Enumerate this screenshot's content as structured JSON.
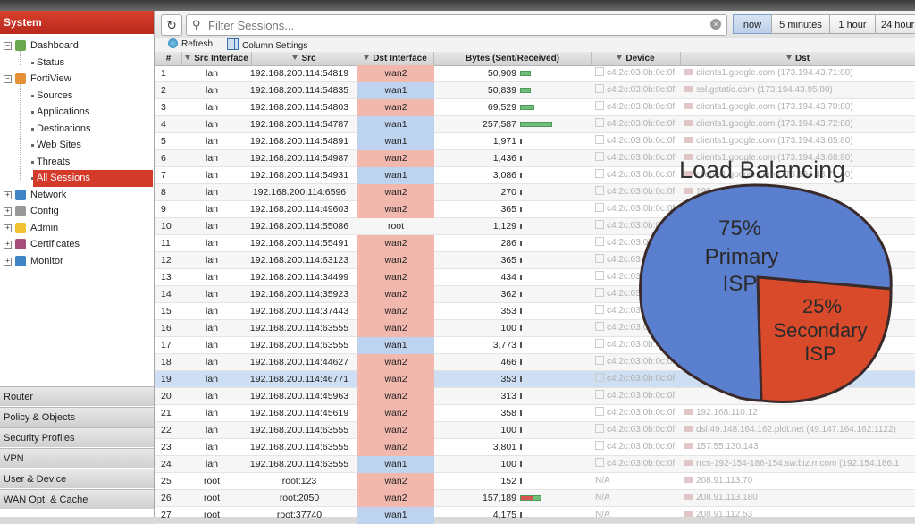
{
  "sidebar": {
    "header": "System",
    "tree": [
      {
        "label": "Dashboard",
        "icon": "dashboard-icon",
        "type": "folder"
      },
      {
        "label": "Status",
        "type": "child"
      },
      {
        "label": "FortiView",
        "icon": "fortiview-icon",
        "type": "folder"
      },
      {
        "label": "Sources",
        "type": "child"
      },
      {
        "label": "Applications",
        "type": "child"
      },
      {
        "label": "Destinations",
        "type": "child"
      },
      {
        "label": "Web Sites",
        "type": "child"
      },
      {
        "label": "Threats",
        "type": "child"
      },
      {
        "label": "All Sessions",
        "type": "child",
        "selected": true
      },
      {
        "label": "Network",
        "icon": "network-icon",
        "type": "folder"
      },
      {
        "label": "Config",
        "icon": "config-icon",
        "type": "folder"
      },
      {
        "label": "Admin",
        "icon": "admin-icon",
        "type": "folder"
      },
      {
        "label": "Certificates",
        "icon": "certificates-icon",
        "type": "folder"
      },
      {
        "label": "Monitor",
        "icon": "monitor-icon",
        "type": "folder"
      }
    ],
    "sections": [
      "Router",
      "Policy & Objects",
      "Security Profiles",
      "VPN",
      "User & Device",
      "WAN Opt. & Cache"
    ]
  },
  "filter": {
    "placeholder": "Filter Sessions..."
  },
  "time_buttons": [
    {
      "label": "now",
      "active": true
    },
    {
      "label": "5 minutes"
    },
    {
      "label": "1 hour"
    },
    {
      "label": "24 hour"
    }
  ],
  "toolbar": {
    "refresh": "Refresh",
    "columns": "Column Settings"
  },
  "columns": [
    "#",
    "Src Interface",
    "Src",
    "Dst Interface",
    "Bytes (Sent/Received)",
    "Device",
    "Dst"
  ],
  "rows": [
    {
      "n": "1",
      "si": "lan",
      "src": "192.168.200.114:54819",
      "dst": "wan2",
      "bytes": "50,909",
      "frac": 0.15,
      "dev": "c4:2c:03:0b:0c:0f",
      "dest": "clients1.google.com (173.194.43.71:80)"
    },
    {
      "n": "2",
      "si": "lan",
      "src": "192.168.200.114:54835",
      "dst": "wan1",
      "bytes": "50,839",
      "frac": 0.15,
      "dev": "c4:2c:03:0b:0c:0f",
      "dest": "ssl.gstatic.com (173.194.43.95:80)"
    },
    {
      "n": "3",
      "si": "lan",
      "src": "192.168.200.114:54803",
      "dst": "wan2",
      "bytes": "69,529",
      "frac": 0.2,
      "dev": "c4:2c:03:0b:0c:0f",
      "dest": "clients1.google.com (173.194.43.70:80)"
    },
    {
      "n": "4",
      "si": "lan",
      "src": "192.168.200.114:54787",
      "dst": "wan1",
      "bytes": "257,587",
      "frac": 0.45,
      "dev": "c4:2c:03:0b:0c:0f",
      "dest": "clients1.google.com (173.194.43.72:80)"
    },
    {
      "n": "5",
      "si": "lan",
      "src": "192.168.200.114:54891",
      "dst": "wan1",
      "bytes": "1,971",
      "frac": 0.02,
      "dev": "c4:2c:03:0b:0c:0f",
      "dest": "clients1.google.com (173.194.43.65:80)"
    },
    {
      "n": "6",
      "si": "lan",
      "src": "192.168.200.114:54987",
      "dst": "wan2",
      "bytes": "1,436",
      "frac": 0.02,
      "dev": "c4:2c:03:0b:0c:0f",
      "dest": "clients1.google.com (173.194.43.68:80)"
    },
    {
      "n": "7",
      "si": "lan",
      "src": "192.168.200.114:54931",
      "dst": "wan1",
      "bytes": "3,086",
      "frac": 0.02,
      "dev": "c4:2c:03:0b:0c:0f",
      "dest": "clients1.google.com (173.194.43.71:80)"
    },
    {
      "n": "8",
      "si": "lan",
      "src": "192.168.200.114:6596",
      "dst": "wan2",
      "bytes": "270",
      "frac": 0.01,
      "dev": "c4:2c:03:0b:0c:0f",
      "dest": "192.168.110.12"
    },
    {
      "n": "9",
      "si": "lan",
      "src": "192.168.200.114:49603",
      "dst": "wan2",
      "bytes": "365",
      "frac": 0.01,
      "dev": "c4:2c:03:0b:0c:0f",
      "dest": ""
    },
    {
      "n": "10",
      "si": "lan",
      "src": "192.168.200.114:55086",
      "dst": "root",
      "bytes": "1,129",
      "frac": 0.01,
      "dev": "c4:2c:03:0b:0c:0f",
      "dest": ""
    },
    {
      "n": "11",
      "si": "lan",
      "src": "192.168.200.114:55491",
      "dst": "wan2",
      "bytes": "286",
      "frac": 0.01,
      "dev": "c4:2c:03:0b:0c:0f",
      "dest": ""
    },
    {
      "n": "12",
      "si": "lan",
      "src": "192.168.200.114:63123",
      "dst": "wan2",
      "bytes": "365",
      "frac": 0.01,
      "dev": "c4:2c:03:0b:0c:0f",
      "dest": ""
    },
    {
      "n": "13",
      "si": "lan",
      "src": "192.168.200.114:34499",
      "dst": "wan2",
      "bytes": "434",
      "frac": 0.01,
      "dev": "c4:2c:03:0b:0c:0f",
      "dest": ""
    },
    {
      "n": "14",
      "si": "lan",
      "src": "192.168.200.114:35923",
      "dst": "wan2",
      "bytes": "362",
      "frac": 0.01,
      "dev": "c4:2c:03:0b:0c:0f",
      "dest": ""
    },
    {
      "n": "15",
      "si": "lan",
      "src": "192.168.200.114:37443",
      "dst": "wan2",
      "bytes": "353",
      "frac": 0.01,
      "dev": "c4:2c:03:0b:0c:0f",
      "dest": ""
    },
    {
      "n": "16",
      "si": "lan",
      "src": "192.168.200.114:63555",
      "dst": "wan2",
      "bytes": "100",
      "frac": 0.01,
      "dev": "c4:2c:03:0b:0c:0f",
      "dest": ".net"
    },
    {
      "n": "17",
      "si": "lan",
      "src": "192.168.200.114:63555",
      "dst": "wan1",
      "bytes": "3,773",
      "frac": 0.02,
      "dev": "c4:2c:03:0b:0c:0f",
      "dest": ""
    },
    {
      "n": "18",
      "si": "lan",
      "src": "192.168.200.114:44627",
      "dst": "wan2",
      "bytes": "466",
      "frac": 0.01,
      "dev": "c4:2c:03:0b:0c:0f",
      "dest": ""
    },
    {
      "n": "19",
      "si": "lan",
      "src": "192.168.200.114:46771",
      "dst": "wan2",
      "bytes": "353",
      "frac": 0.01,
      "dev": "c4:2c:03:0b:0c:0f",
      "dest": "",
      "selected": true
    },
    {
      "n": "20",
      "si": "lan",
      "src": "192.168.200.114:45963",
      "dst": "wan2",
      "bytes": "313",
      "frac": 0.01,
      "dev": "c4:2c:03:0b:0c:0f",
      "dest": ""
    },
    {
      "n": "21",
      "si": "lan",
      "src": "192.168.200.114:45619",
      "dst": "wan2",
      "bytes": "358",
      "frac": 0.01,
      "dev": "c4:2c:03:0b:0c:0f",
      "dest": "192.168.110.12"
    },
    {
      "n": "22",
      "si": "lan",
      "src": "192.168.200.114:63555",
      "dst": "wan2",
      "bytes": "100",
      "frac": 0.01,
      "dev": "c4:2c:03:0b:0c:0f",
      "dest": "dsl.49.148.164.162.pldt.net (49.147.164.162:1122)"
    },
    {
      "n": "23",
      "si": "lan",
      "src": "192.168.200.114:63555",
      "dst": "wan2",
      "bytes": "3,801",
      "frac": 0.02,
      "dev": "c4:2c:03:0b:0c:0f",
      "dest": "157.55.130.143"
    },
    {
      "n": "24",
      "si": "lan",
      "src": "192.168.200.114:63555",
      "dst": "wan1",
      "bytes": "100",
      "frac": 0.01,
      "dev": "c4:2c:03:0b:0c:0f",
      "dest": "rrcs-192-154-186-154.sw.biz.rr.com (192.154.186.1"
    },
    {
      "n": "25",
      "si": "root",
      "src": "root:123",
      "dst": "wan2",
      "bytes": "152",
      "frac": 0.01,
      "dev": "N/A",
      "dest": "208.91.113.70"
    },
    {
      "n": "26",
      "si": "root",
      "src": "root:2050",
      "dst": "wan2",
      "bytes": "157,189",
      "frac": 0.3,
      "rx": 0.6,
      "dev": "N/A",
      "dest": "208.91.113.180"
    },
    {
      "n": "27",
      "si": "root",
      "src": "root:37740",
      "dst": "wan1",
      "bytes": "4,175",
      "frac": 0.02,
      "dev": "N/A",
      "dest": "208.91.112.53"
    }
  ],
  "overlay": {
    "title": "Load Balancing",
    "primary_pct": "75%",
    "primary_line1": "Primary",
    "primary_line2": "ISP",
    "secondary_pct": "25%",
    "secondary_line1": "Secondary",
    "secondary_line2": "ISP",
    "colors": {
      "primary": "#5b7fcf",
      "secondary": "#d94a2b"
    }
  }
}
